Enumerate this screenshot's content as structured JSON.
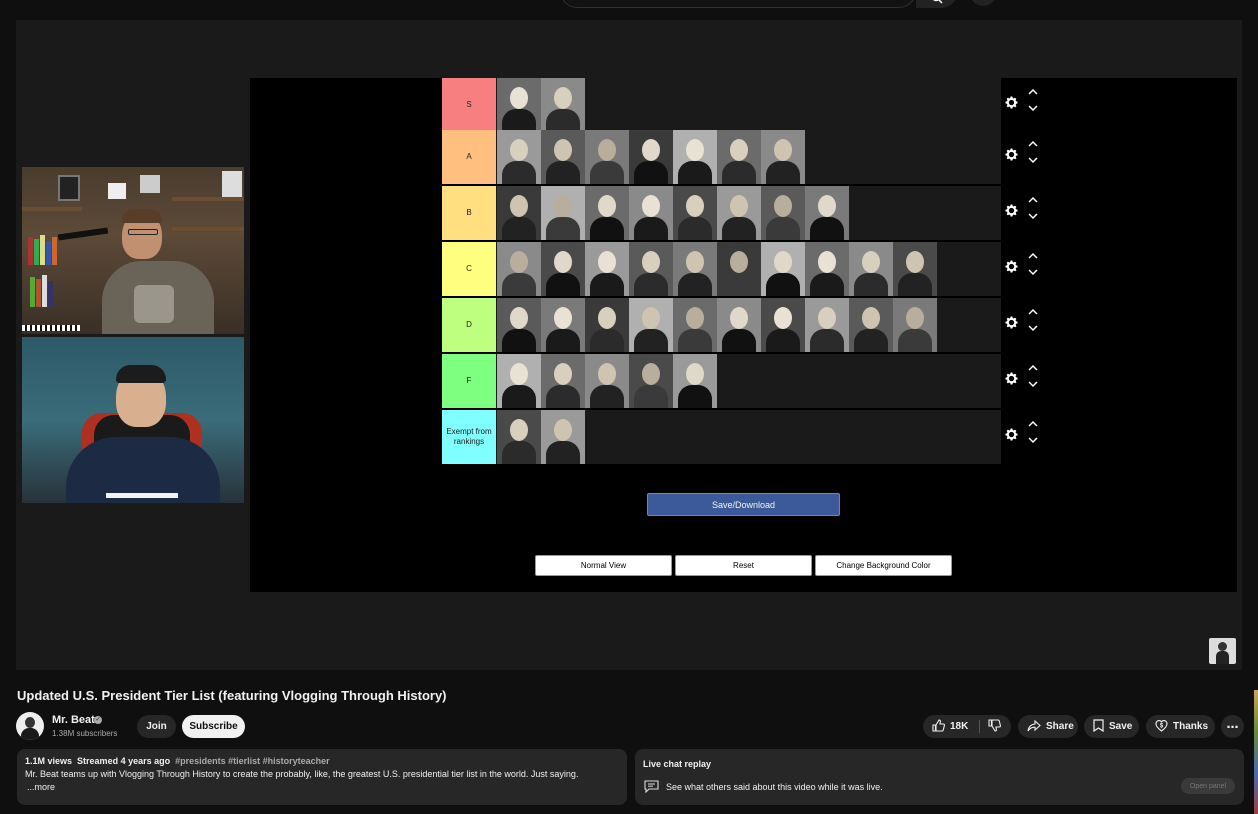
{
  "tier_list": {
    "tiers": [
      {
        "label": "S",
        "color": "#f87f7f",
        "count": 2
      },
      {
        "label": "A",
        "color": "#ffbf7f",
        "count": 7
      },
      {
        "label": "B",
        "color": "#ffdf7f",
        "count": 8
      },
      {
        "label": "C",
        "color": "#ffff7f",
        "count": 10
      },
      {
        "label": "D",
        "color": "#bfff7f",
        "count": 10
      },
      {
        "label": "F",
        "color": "#7fff7f",
        "count": 5
      },
      {
        "label": "Exempt from rankings",
        "color": "#7fffff",
        "count": 2
      }
    ],
    "save_download_label": "Save/Download",
    "normal_view_label": "Normal View",
    "reset_label": "Reset",
    "change_bg_label": "Change Background Color"
  },
  "video": {
    "title": "Updated U.S. President Tier List (featuring Vlogging Through History)"
  },
  "channel": {
    "name": "Mr. Beat",
    "subscribers": "1.38M subscribers",
    "join_label": "Join",
    "subscribe_label": "Subscribe"
  },
  "actions": {
    "likes": "18K",
    "share_label": "Share",
    "save_label": "Save",
    "thanks_label": "Thanks"
  },
  "description": {
    "views": "1.1M views",
    "streamed": "Streamed 4 years ago",
    "tags": "#presidents #tierlist #historyteacher",
    "text": "Mr. Beat teams up with Vlogging Through History to create the probably, like, the greatest U.S. presidential tier list in the world. Just saying.",
    "more_label": "...more"
  },
  "chat": {
    "title": "Live chat replay",
    "text": "See what others said about this video while it was live.",
    "open_panel_label": "Open panel"
  }
}
